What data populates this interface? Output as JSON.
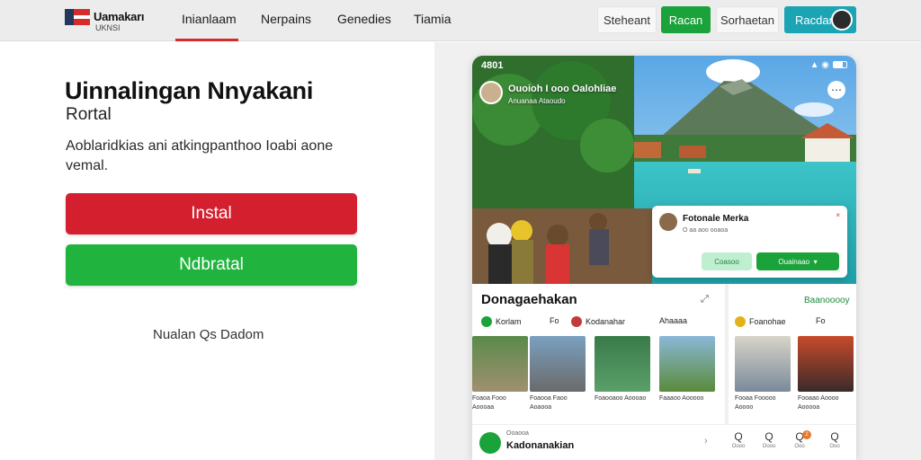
{
  "brand": {
    "name": "Uamakarı",
    "sub": "UKNSI"
  },
  "nav": [
    "Inianlaam",
    "Nerpains",
    "Genedies",
    "Tiamia"
  ],
  "header_buttons": {
    "secondary": "Steheant",
    "primary": "Racan",
    "third": "Sorhaetan",
    "account": "Racdan"
  },
  "hero": {
    "title": "Uinnalingan Nnyakani",
    "subtitle": "Rortal",
    "description": "Aoblaridkias ani atkingpanthoo Ioabi aone vemal.",
    "primary_cta": "Instal",
    "secondary_cta": "Ndbratal",
    "link": "Nualan Qs Dadom"
  },
  "phone": {
    "status_time": "4801",
    "header_title": "Ouoioh I ooo Oalohliae",
    "header_sub": "Anuanaa  Ataoudo",
    "card": {
      "name": "Fotonale Merka",
      "meta": "O  aa aoo ooaoa",
      "close": "×",
      "button1": "Coasoo",
      "button2": "Ouainaao"
    },
    "section_title": "Donagaehakan",
    "section2_title": "Baanooooy",
    "filters": [
      "Korlam",
      "Fo",
      "Kodanahar",
      "Ahaaaa",
      "Foanohae",
      "Fo"
    ],
    "captions": [
      "Foaoa Fooo  Aoooaa",
      "Foaooa Faoo  Aoaooa",
      "Foaooaoo  Aoooao",
      "Faaaoo  Aooooo",
      "Fooaa Fooooo  Aoooo",
      "Fooaao Aoooo  Aooooa"
    ],
    "bottom": {
      "small": "Ooaooa",
      "label": "Kadonanakian"
    },
    "tabs": [
      "Q",
      "Q",
      "Q",
      "Q"
    ],
    "tab_labels": [
      "Oooo",
      "Oooo",
      "Ooo",
      "Ooo"
    ],
    "badge": "2"
  },
  "colors": {
    "red": "#d4202e",
    "green": "#20b43e",
    "teal": "#1aa4b4"
  }
}
